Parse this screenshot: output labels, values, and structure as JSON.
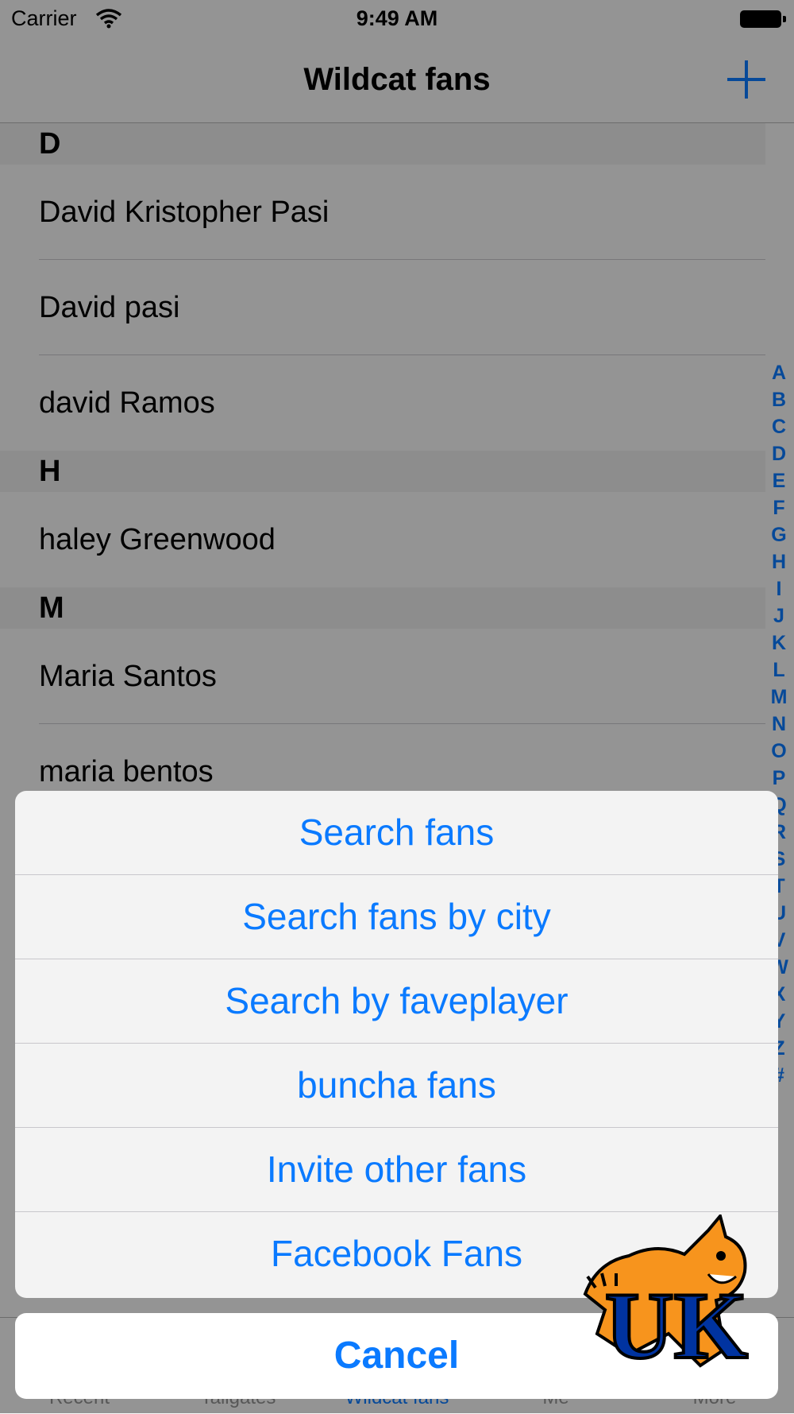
{
  "status_bar": {
    "carrier": "Carrier",
    "time": "9:49 AM"
  },
  "nav": {
    "title": "Wildcat fans",
    "add_icon": "plus-icon"
  },
  "sections": [
    {
      "letter": "D",
      "names": [
        "David Kristopher Pasi",
        "David pasi",
        "david Ramos"
      ]
    },
    {
      "letter": "H",
      "names": [
        "haley Greenwood"
      ]
    },
    {
      "letter": "M",
      "names": [
        "Maria Santos",
        "maria bentos"
      ]
    }
  ],
  "index": [
    "A",
    "B",
    "C",
    "D",
    "E",
    "F",
    "G",
    "H",
    "I",
    "J",
    "K",
    "L",
    "M",
    "N",
    "O",
    "P",
    "Q",
    "R",
    "S",
    "T",
    "U",
    "V",
    "W",
    "X",
    "Y",
    "Z",
    "#"
  ],
  "tabs": [
    "Recent",
    "Tailgates",
    "Wildcat fans",
    "Me",
    "More"
  ],
  "active_tab": "Wildcat fans",
  "action_sheet": {
    "options": [
      "Search fans",
      "Search fans by city",
      "Search by faveplayer",
      "buncha fans",
      "Invite other fans",
      "Facebook Fans"
    ],
    "cancel": "Cancel"
  },
  "logo": {
    "text": "UK"
  },
  "colors": {
    "accent": "#0a7aff",
    "logo_orange": "#f7941d",
    "logo_blue": "#0033a0"
  }
}
